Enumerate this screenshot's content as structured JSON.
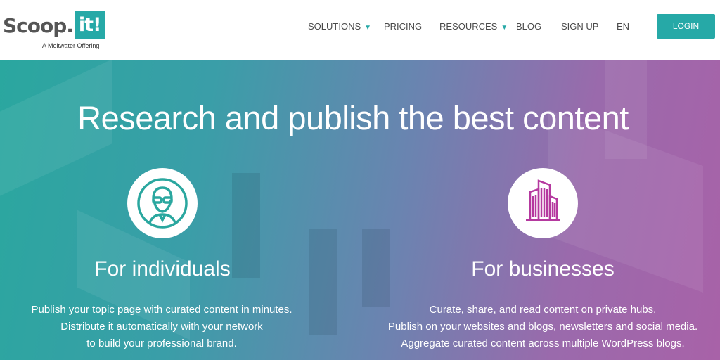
{
  "logo": {
    "main": "Scoop.",
    "badge": "it!",
    "sub": "A Meltwater Offering"
  },
  "nav": {
    "items": [
      {
        "label": "SOLUTIONS",
        "has_dropdown": true
      },
      {
        "label": "PRICING",
        "has_dropdown": false
      },
      {
        "label": "RESOURCES",
        "has_dropdown": true
      },
      {
        "label": "BLOG",
        "has_dropdown": false
      },
      {
        "label": "SIGN UP",
        "has_dropdown": false
      },
      {
        "label": "EN",
        "has_dropdown": false
      }
    ],
    "caret": "▼",
    "login_label": "LOGIN"
  },
  "hero": {
    "title": "Research and publish the best content",
    "individuals": {
      "title": "For individuals",
      "icon": "person-glasses-icon",
      "lines": [
        "Publish your topic page with curated content in minutes.",
        "Distribute it automatically with your network",
        "to build your professional brand."
      ]
    },
    "businesses": {
      "title": "For businesses",
      "icon": "building-icon",
      "lines": [
        "Curate, share, and read content on private hubs.",
        "Publish on your websites and blogs, newsletters and social media.",
        "Aggregate curated content across multiple WordPress blogs."
      ]
    }
  },
  "colors": {
    "accent": "#26a9a7",
    "icon_teal": "#2aa79f",
    "icon_magenta": "#b5399f"
  }
}
